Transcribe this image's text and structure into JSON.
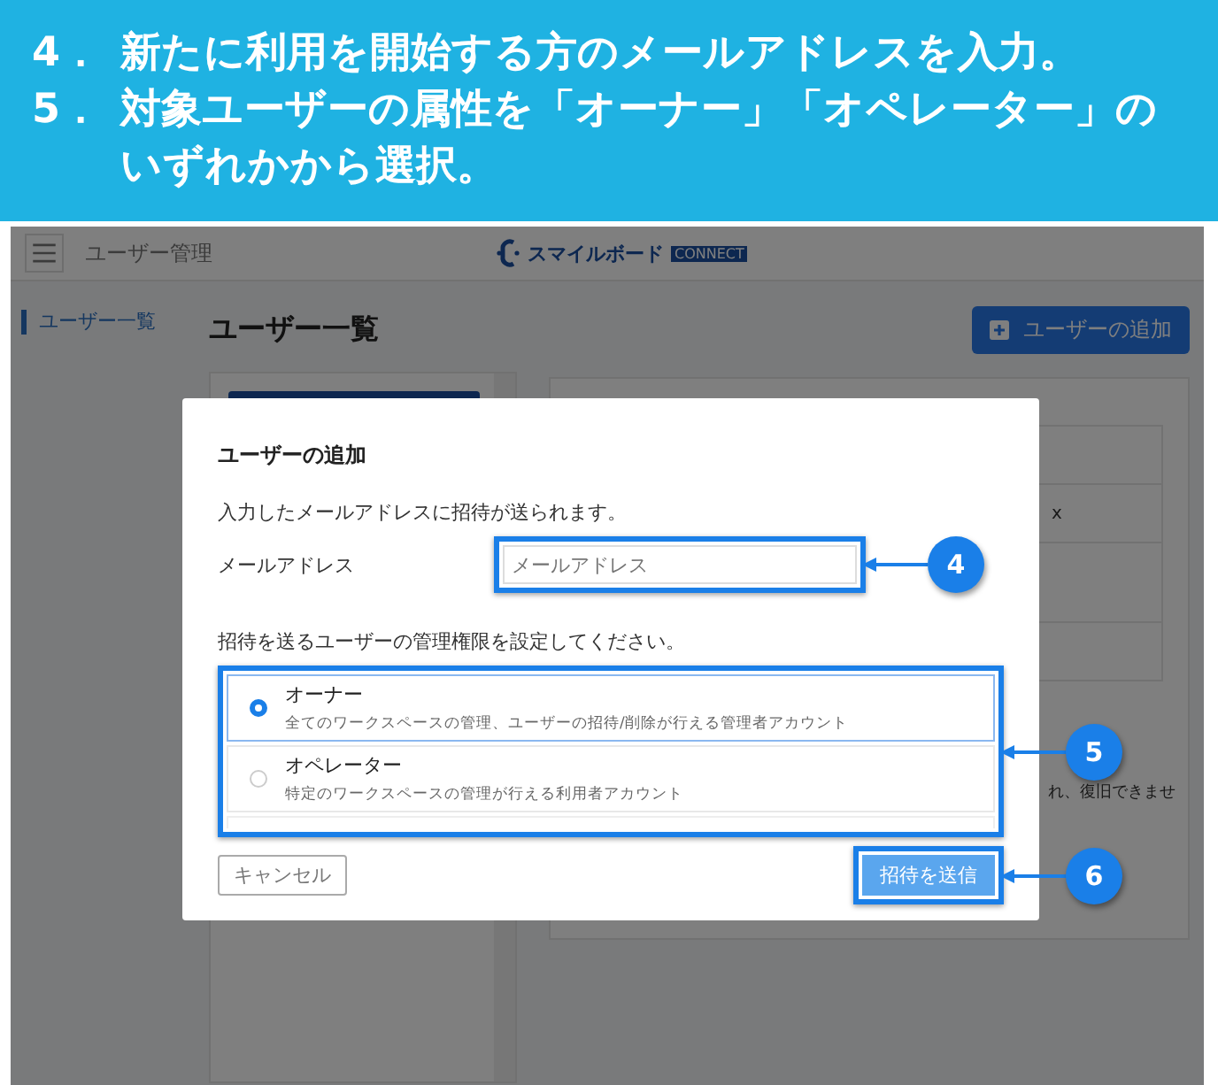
{
  "instructions": [
    {
      "number": "4．",
      "text": "新たに利用を開始する方のメールアドレスを入力。"
    },
    {
      "number": "5．",
      "text": "対象ユーザーの属性を「オーナー」「オペレーター」のいずれかから選択。"
    }
  ],
  "header": {
    "title": "ユーザー管理",
    "logo": "スマイルボード",
    "logo_badge": "CONNECT"
  },
  "sidebar": {
    "items": [
      {
        "label": "ユーザー一覧",
        "selected": true
      }
    ]
  },
  "page": {
    "title": "ユーザー一覧",
    "add_button": "ユーザーの追加",
    "detail_fragments": [
      "x",
      "れ、復旧できませ"
    ]
  },
  "dialog": {
    "title": "ユーザーの追加",
    "description": "入力したメールアドレスに招待が送られます。",
    "email": {
      "label": "メールアドレス",
      "placeholder": "メールアドレス"
    },
    "role_prompt": "招待を送るユーザーの管理権限を設定してください。",
    "roles": [
      {
        "name": "オーナー",
        "description": "全てのワークスペースの管理、ユーザーの招待/削除が行える管理者アカウント",
        "selected": true
      },
      {
        "name": "オペレーター",
        "description": "特定のワークスペースの管理が行える利用者アカウント",
        "selected": false
      }
    ],
    "cancel": "キャンセル",
    "submit": "招待を送信"
  },
  "callouts": [
    "4",
    "5",
    "6"
  ]
}
